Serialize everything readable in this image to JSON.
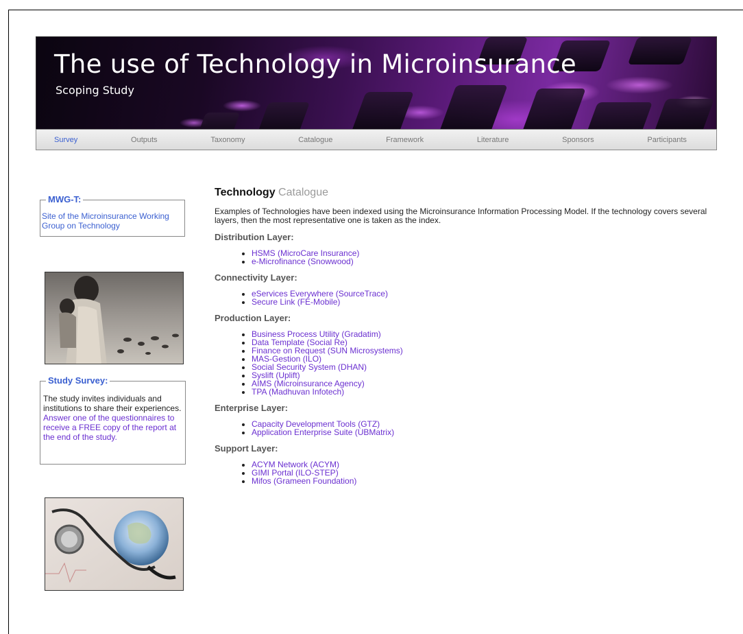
{
  "banner": {
    "title": "The use of Technology in Microinsurance",
    "subtitle": "Scoping Study"
  },
  "nav": {
    "items": [
      "Survey",
      "Outputs",
      "Taxonomy",
      "Catalogue",
      "Framework",
      "Literature",
      "Sponsors",
      "Participants"
    ],
    "active": "Survey",
    "active_color": "#3a5fd0"
  },
  "sidebar": {
    "mwgt": {
      "legend": "MWG-T:",
      "link_text": "Site of the Microinsurance Working Group on Technology"
    },
    "study_survey": {
      "legend": "Study Survey:",
      "text": "The study invites individuals and institutions to share their experiences.",
      "link_text": "Answer one of the questionnaires to receive a FREE copy of the report at the end of the study."
    }
  },
  "main": {
    "heading_bold": "Technology",
    "heading_light": "Catalogue",
    "intro": "Examples of Technologies have been indexed using the Microinsurance Information Processing Model. If the technology covers several layers, then the most representative one is taken as the index.",
    "layers": [
      {
        "title": "Distribution Layer:",
        "items": [
          "HSMS (MicroCare Insurance)",
          "e-Microfinance (Snowwood)"
        ]
      },
      {
        "title": "Connectivity Layer:",
        "items": [
          "eServices Everywhere (SourceTrace)",
          "Secure Link (FE-Mobile)"
        ]
      },
      {
        "title": "Production Layer:",
        "items": [
          "Business Process Utility (Gradatim)",
          "Data Template (Social Re)",
          "Finance on Request (SUN Microsystems)",
          "MAS-Gestion (ILO)",
          "Social Security System (DHAN)",
          "Syslift (Uplift)",
          "AIMS (Microinsurance Agency)",
          "TPA (Madhuvan Infotech)"
        ]
      },
      {
        "title": "Enterprise Layer:",
        "items": [
          "Capacity Development Tools (GTZ)",
          "Application Enterprise Suite (UBMatrix)"
        ]
      },
      {
        "title": "Support Layer:",
        "items": [
          "ACYM Network (ACYM)",
          "GIMI Portal (ILO-STEP)",
          "Mifos (Grameen Foundation)"
        ]
      }
    ]
  },
  "colors": {
    "link_blue": "#3a5fd0",
    "link_purple": "#6a2fd0",
    "banner_purple": "#7a2aa0"
  }
}
